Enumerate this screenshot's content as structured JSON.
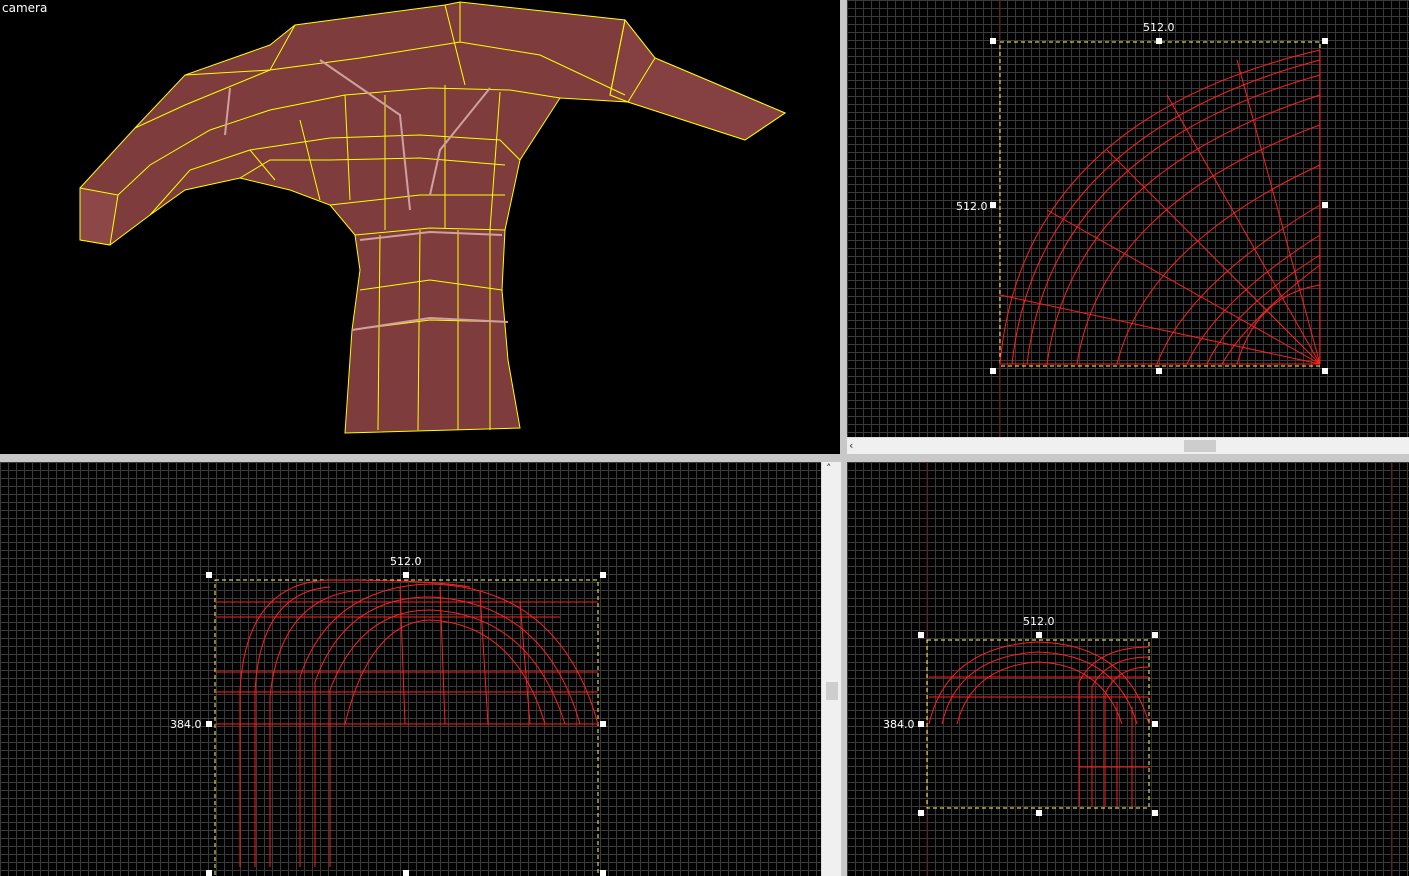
{
  "viewports": {
    "camera": {
      "label": "camera"
    },
    "top": {
      "width_label": "512.0",
      "height_label": "512.0"
    },
    "front": {
      "width_label": "512.0",
      "height_label": "384.0"
    },
    "side": {
      "width_label": "512.0",
      "height_label": "384.0"
    }
  },
  "scrollbars": {
    "left_arrow": "‹",
    "up_arrow": "˄"
  },
  "colors": {
    "brush_fill": "#7f3c3c",
    "selection_edge": "#ffff00",
    "wireframe": "#ff2020",
    "grid": "#3a3a3a",
    "viewport_bg": "#000000"
  }
}
